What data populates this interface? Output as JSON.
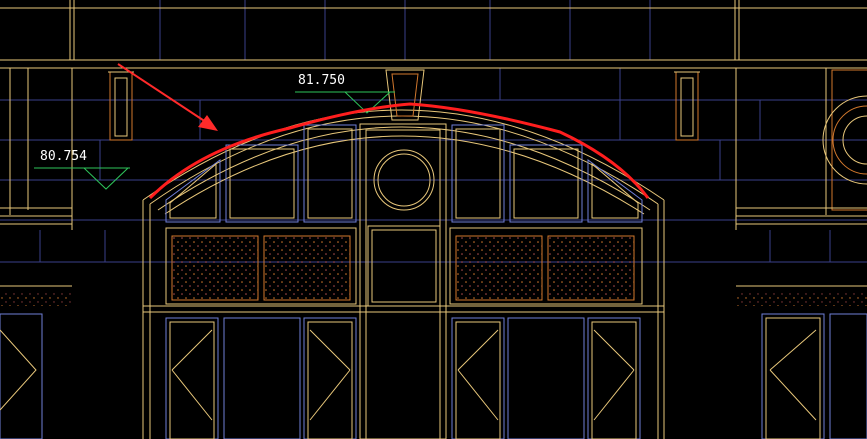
{
  "viewport": {
    "background": "#000000"
  },
  "annotations": {
    "elevation_left": "80.754",
    "elevation_top": "81.750"
  },
  "colors": {
    "outline": "#e8c77a",
    "grid": "#3a3f8a",
    "frame": "#6f7fd8",
    "orange": "#d2782d",
    "marker": "#2ec45a",
    "highlight": "#ff1e1e",
    "arrow": "#ff2a2a",
    "text": "#ffffff"
  },
  "icons": {
    "elevation_marker": "triangle-down-icon",
    "pointer": "red-arrow-icon"
  }
}
